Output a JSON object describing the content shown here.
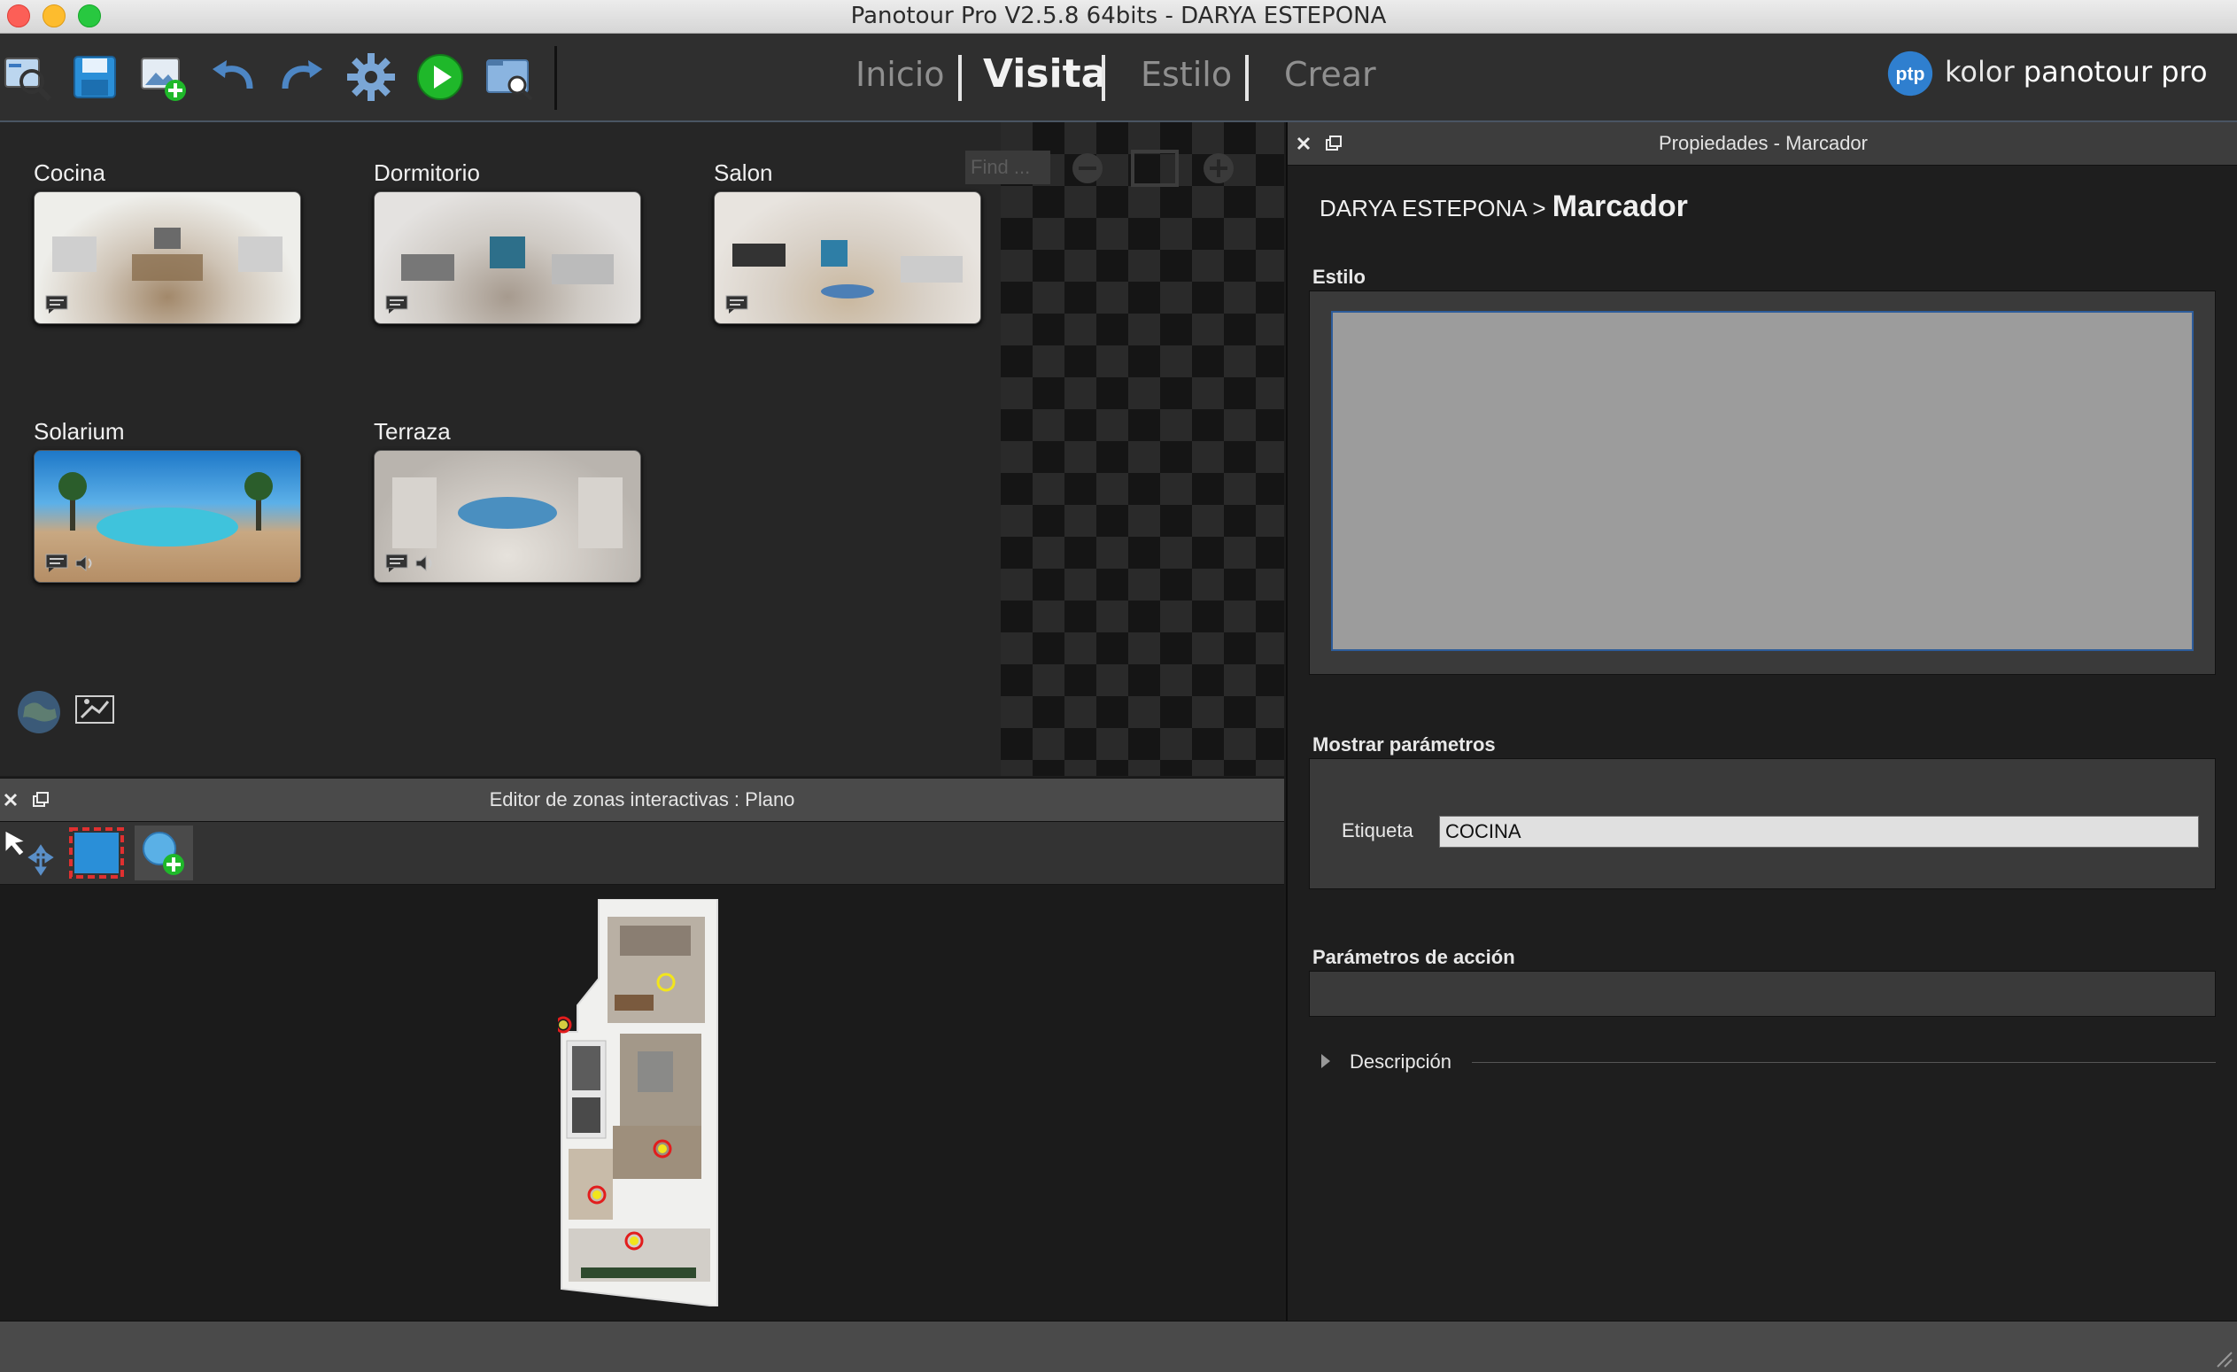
{
  "window": {
    "title": "Panotour Pro V2.5.8 64bits - DARYA ESTEPONA"
  },
  "toolbar": {
    "buttons": [
      {
        "name": "open-project-icon"
      },
      {
        "name": "save-icon"
      },
      {
        "name": "add-panorama-icon"
      },
      {
        "name": "undo-icon"
      },
      {
        "name": "redo-icon"
      },
      {
        "name": "settings-gear-icon"
      },
      {
        "name": "play-icon"
      },
      {
        "name": "preview-folder-icon"
      }
    ],
    "modes": {
      "inicio": "Inicio",
      "visita": "Visita",
      "estilo": "Estilo",
      "crear": "Crear"
    },
    "active_mode": "Visita",
    "brand_logo": "ptp",
    "brand_name": "kolor",
    "brand_product": "panotour pro"
  },
  "panoramas": {
    "find_placeholder": "Find ...",
    "items": [
      {
        "label": "Cocina",
        "icons": [
          "comment-icon"
        ]
      },
      {
        "label": "Dormitorio",
        "icons": [
          "comment-icon"
        ]
      },
      {
        "label": "Salon",
        "icons": [
          "comment-icon"
        ]
      },
      {
        "label": "Solarium",
        "icons": [
          "comment-icon",
          "sound-icon"
        ]
      },
      {
        "label": "Terraza",
        "icons": [
          "comment-icon",
          "sound-icon"
        ]
      }
    ]
  },
  "hotspot_editor": {
    "title": "Editor de zonas interactivas : Plano",
    "tools": [
      "move-select-tool-icon",
      "rectangle-select-tool-icon",
      "add-spot-tool-icon"
    ],
    "active_tool": "add-spot-tool-icon",
    "spot_colors": {
      "active": "#f2e51c",
      "inactive": "#e21d1d"
    }
  },
  "properties": {
    "title": "Propiedades - Marcador",
    "breadcrumb_parent": "DARYA ESTEPONA >",
    "breadcrumb_current": "Marcador",
    "estilo_title": "Estilo",
    "mostrar_title": "Mostrar parámetros",
    "etiqueta_label": "Etiqueta",
    "etiqueta_value": "COCINA",
    "accion_title": "Parámetros de acción",
    "descripcion_label": "Descripción"
  },
  "colors": {
    "accent": "#2d5c9a",
    "play": "#1fb82a",
    "save": "#2a8fd8"
  }
}
